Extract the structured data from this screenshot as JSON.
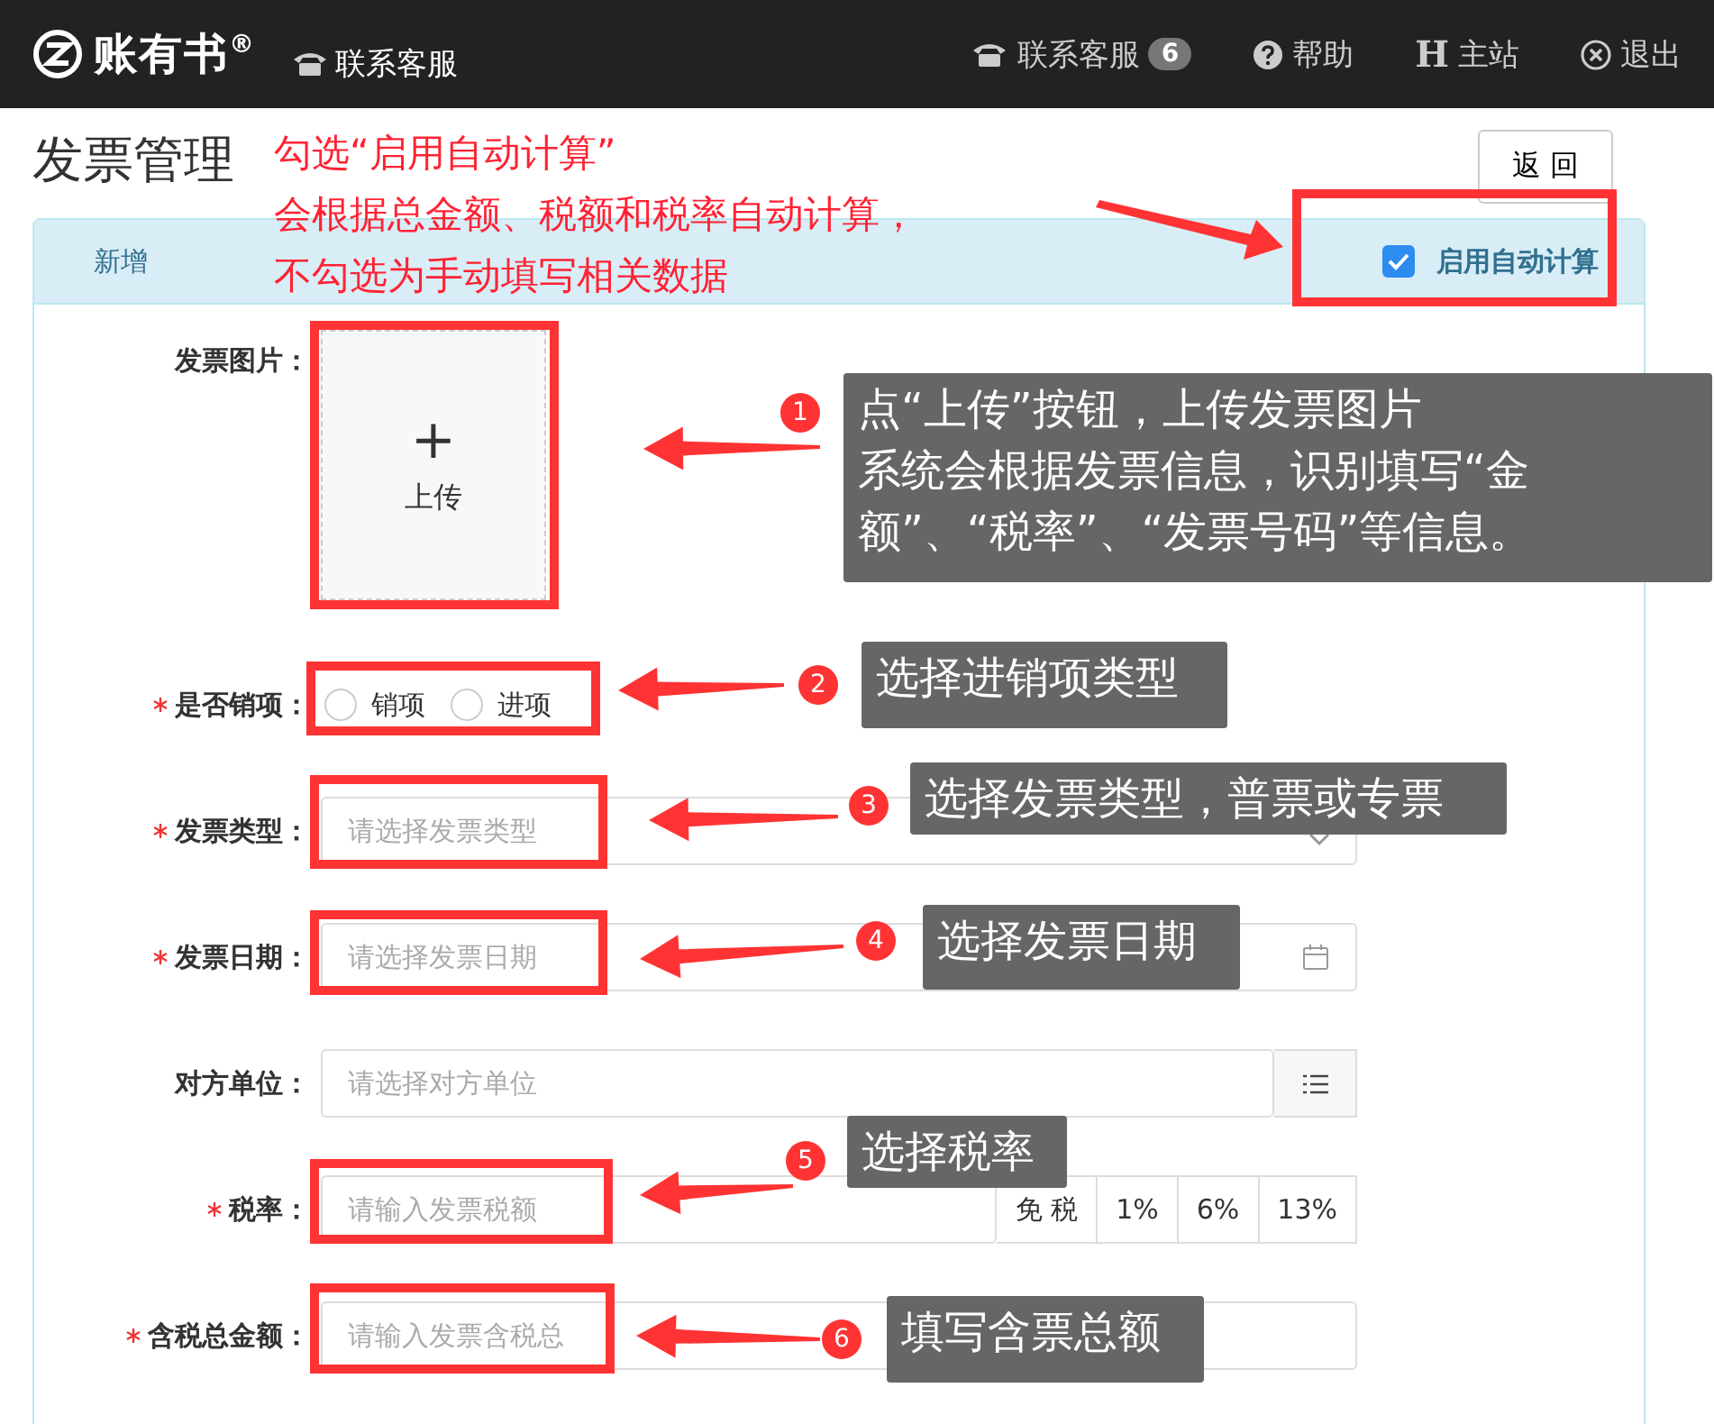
{
  "topbar": {
    "logo": "账有书$^{®}$",
    "service_link": "联系客服",
    "nav": [
      {
        "kind": "phone",
        "label": "联系客服",
        "badge": "6"
      },
      {
        "kind": "help",
        "label": "帮助"
      },
      {
        "kind": "glyph",
        "glyph": "H",
        "label": "主站"
      },
      {
        "kind": "logout",
        "label": "退出"
      }
    ]
  },
  "page": {
    "title": "发票管理",
    "back_button": "返 回"
  },
  "panel": {
    "header": "新增",
    "auto_calc": {
      "label": "启用自动计算",
      "checked": true
    }
  },
  "form": [
    {
      "kind": "upload",
      "label": "发票图片：",
      "required": false,
      "icon": "+",
      "button": "上传"
    },
    {
      "kind": "radio",
      "label": "是否销项：",
      "required": true,
      "options": [
        {
          "label": "销项",
          "selected": false
        },
        {
          "label": "进项",
          "selected": false
        }
      ]
    },
    {
      "kind": "select",
      "label": "发票类型：",
      "required": true,
      "placeholder": "请选择发票类型"
    },
    {
      "kind": "date",
      "label": "发票日期：",
      "required": true,
      "placeholder": "请选择发票日期"
    },
    {
      "kind": "picker",
      "label": "对方单位：",
      "required": false,
      "placeholder": "请选择对方单位"
    },
    {
      "kind": "rate",
      "label": "税率：",
      "required": true,
      "placeholder": "请输入发票税额",
      "rates": [
        "免 税",
        "1%",
        "6%",
        "13%"
      ]
    },
    {
      "kind": "input",
      "label": "含税总金额：",
      "required": true,
      "placeholder": "请输入发票含税总"
    }
  ],
  "annotations": {
    "top_note": [
      "勾选“启用自动计算”",
      "会根据总金额、税额和税率自动计算，",
      "不勾选为手动填写相关数据"
    ],
    "callouts": [
      {
        "number": "1",
        "lines": [
          "点“上传”按钮，上传发票图片",
          "系统会根据发票信息，识别填写“金额”、“税率”、“发票号码”等信息。"
        ]
      },
      {
        "number": "2",
        "lines": [
          "选择进销项类型"
        ]
      },
      {
        "number": "3",
        "lines": [
          "选择发票类型，普票或专票"
        ]
      },
      {
        "number": "4",
        "lines": [
          "选择发票日期"
        ]
      },
      {
        "number": "5",
        "lines": [
          "选择税率"
        ]
      },
      {
        "number": "6",
        "lines": [
          "填写含票总额"
        ]
      }
    ]
  }
}
